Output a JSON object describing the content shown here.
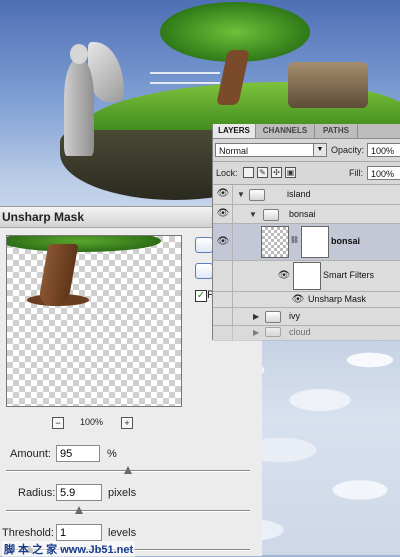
{
  "dialog": {
    "title": "Unsharp Mask",
    "zoom_label": "100%",
    "zoom_out": "−",
    "zoom_in": "+",
    "preview_check_label": "P",
    "amount": {
      "label": "Amount:",
      "value": "95",
      "unit": "%",
      "level": 0.5
    },
    "radius": {
      "label": "Radius:",
      "value": "5.9",
      "unit": "pixels",
      "level": 0.3
    },
    "threshold": {
      "label": "Threshold:",
      "value": "1",
      "unit": "levels",
      "level": 0.1
    }
  },
  "layers_panel": {
    "tabs": [
      "LAYERS",
      "CHANNELS",
      "PATHS"
    ],
    "active_tab": "LAYERS",
    "blend_mode": "Normal",
    "opacity_label": "Opacity:",
    "opacity_value": "100%",
    "lock_label": "Lock:",
    "fill_label": "Fill:",
    "fill_value": "100%",
    "layers": [
      {
        "name": "island",
        "type": "group",
        "expanded": true
      },
      {
        "name": "bonsai",
        "type": "group",
        "expanded": true
      },
      {
        "name": "bonsai",
        "type": "smart-object",
        "selected": true
      },
      {
        "name": "Smart Filters",
        "type": "filter-mask"
      },
      {
        "name": "Unsharp Mask",
        "type": "filter"
      },
      {
        "name": "ivy",
        "type": "group",
        "expanded": false
      },
      {
        "name": "cloud",
        "type": "group",
        "expanded": false
      }
    ]
  },
  "watermark": "脚 本 之 家 www.Jb51.net",
  "colors": {
    "selected_row": "#c3c7d6",
    "panel_bg": "#d8d8d8",
    "dialog_bg": "#ececec"
  }
}
